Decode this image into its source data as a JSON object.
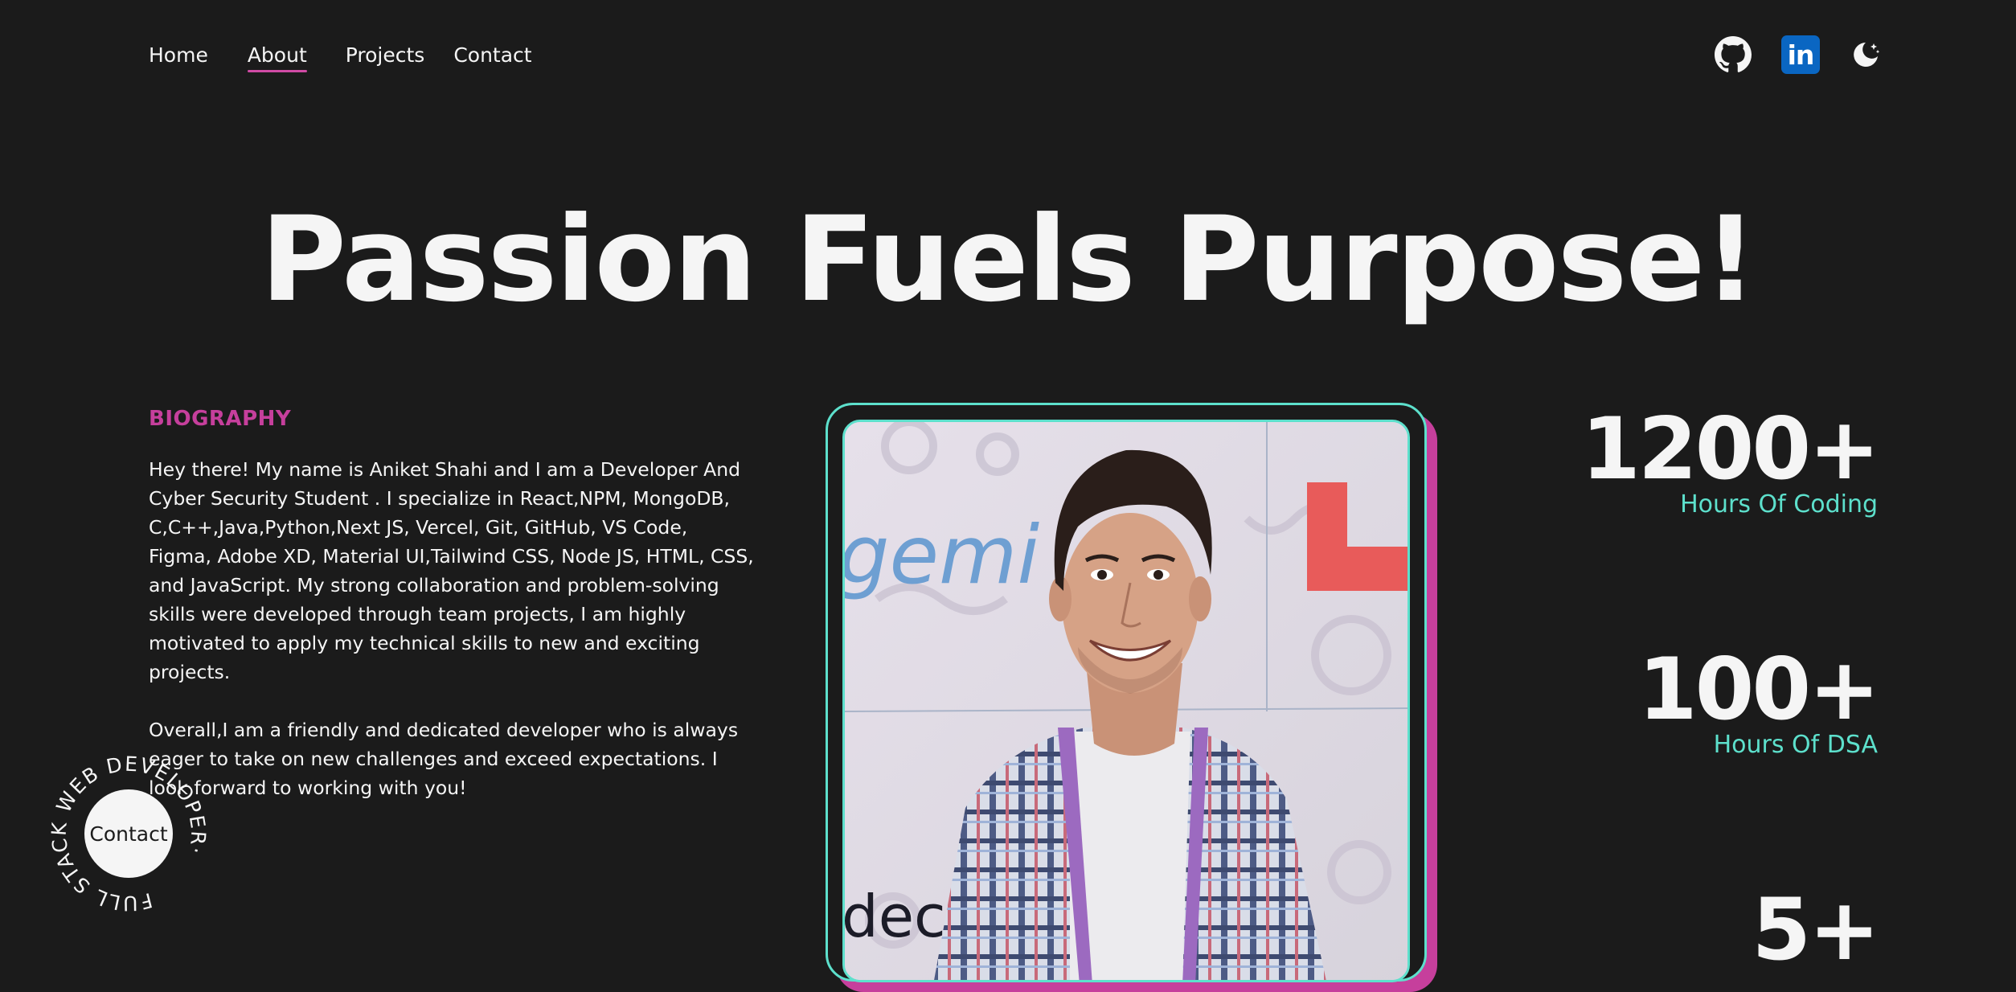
{
  "nav": {
    "items": [
      {
        "label": "Home"
      },
      {
        "label": "About"
      },
      {
        "label": "Projects"
      },
      {
        "label": "Contact"
      }
    ],
    "active": "About"
  },
  "social": {
    "github_icon": "github-icon",
    "linkedin_label": "in",
    "theme_icon": "moon-icon"
  },
  "hero": {
    "title": "Passion Fuels Purpose!"
  },
  "bio": {
    "heading": "BIOGRAPHY",
    "paragraph1": "Hey there! My name is Aniket Shahi and I am a Developer And Cyber Security Student . I specialize in React,NPM, MongoDB, C,C++,Java,Python,Next JS, Vercel, Git, GitHub, VS Code, Figma, Adobe XD, Material UI,Tailwind CSS, Node JS, HTML, CSS, and JavaScript. My strong collaboration and problem-solving skills were developed through team projects, I am highly motivated to apply my technical skills to new and exciting projects.",
    "paragraph2": "Overall,I am a friendly and dedicated developer who is always eager to take on new challenges and exceed expectations. I look forward to working with you!"
  },
  "photo": {
    "text_top": "gemi",
    "text_bottom": "dec"
  },
  "stats": [
    {
      "value": "1200+",
      "label": "Hours Of Coding"
    },
    {
      "value": "100+",
      "label": "Hours Of DSA"
    },
    {
      "value": "5+",
      "label": ""
    }
  ],
  "badge": {
    "ring_text": "FULL STACK WEB DEVELOPER·",
    "button_label": "Contact"
  },
  "colors": {
    "background": "#1b1b1b",
    "accent_pink": "#c63f9c",
    "accent_teal": "#5de0cc",
    "text": "#f5f5f5"
  }
}
